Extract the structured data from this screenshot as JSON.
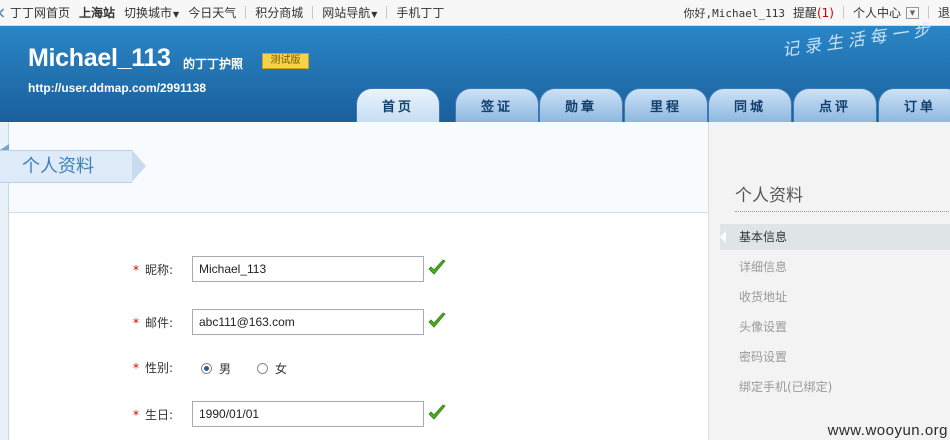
{
  "topbar": {
    "home": "丁丁网首页",
    "city": "上海站",
    "switch_city": "切换城市",
    "weather": "今日天气",
    "points_mall": "积分商城",
    "site_nav": "网站导航",
    "mobile": "手机丁丁",
    "greeting": "你好,Michael_113",
    "remind": "提醒",
    "remind_count": "(1)",
    "user_center": "个人中心",
    "more": "退"
  },
  "header": {
    "username": "Michael_113",
    "passport": "的丁丁护照",
    "test_badge": "测试版",
    "url": "http://user.ddmap.com/2991138",
    "slogan": "记录生活每一步",
    "tabs": [
      "首页",
      "签证",
      "勋章",
      "里程",
      "同城",
      "点评",
      "订单"
    ],
    "active_tab": 0
  },
  "main": {
    "section_title": "个人资料",
    "form": {
      "nickname": {
        "required": "*",
        "label": "昵称:",
        "value": "Michael_113"
      },
      "email": {
        "required": "*",
        "label": "邮件:",
        "value": "abc111@163.com"
      },
      "gender": {
        "required": "*",
        "label": "性别:",
        "options": [
          "男",
          "女"
        ],
        "selected": "男"
      },
      "birthday": {
        "required": "*",
        "label": "生日:",
        "value": "1990/01/01"
      }
    }
  },
  "sidebar": {
    "title": "个人资料",
    "items": [
      "基本信息",
      "详细信息",
      "收货地址",
      "头像设置",
      "密码设置",
      "绑定手机(已绑定)"
    ],
    "active": 0
  },
  "watermark": "www.wooyun.org",
  "colors": {
    "header_blue": "#1a6fb0",
    "required_red": "#d00000",
    "check_green": "#4caf1e"
  }
}
